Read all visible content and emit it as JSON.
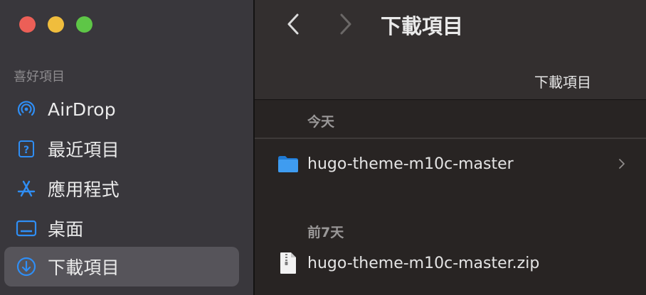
{
  "sidebar": {
    "section_title": "喜好項目",
    "items": [
      {
        "label": "AirDrop",
        "icon": "airdrop-icon"
      },
      {
        "label": "最近項目",
        "icon": "recents-icon"
      },
      {
        "label": "應用程式",
        "icon": "applications-icon"
      },
      {
        "label": "桌面",
        "icon": "desktop-icon"
      },
      {
        "label": "下載項目",
        "icon": "downloads-icon",
        "selected": true
      }
    ]
  },
  "toolbar": {
    "title": "下載項目",
    "column_header": "下載項目"
  },
  "groups": [
    {
      "title": "今天",
      "files": [
        {
          "name": "hugo-theme-m10c-master",
          "kind": "folder",
          "expandable": true
        }
      ]
    },
    {
      "title": "前7天",
      "files": [
        {
          "name": "hugo-theme-m10c-master.zip",
          "kind": "zip",
          "expandable": false
        }
      ]
    }
  ],
  "colors": {
    "accent": "#2f8ef5",
    "sidebar_bg": "#39373c",
    "selected_bg": "#56545a",
    "content_bg": "#282423"
  }
}
